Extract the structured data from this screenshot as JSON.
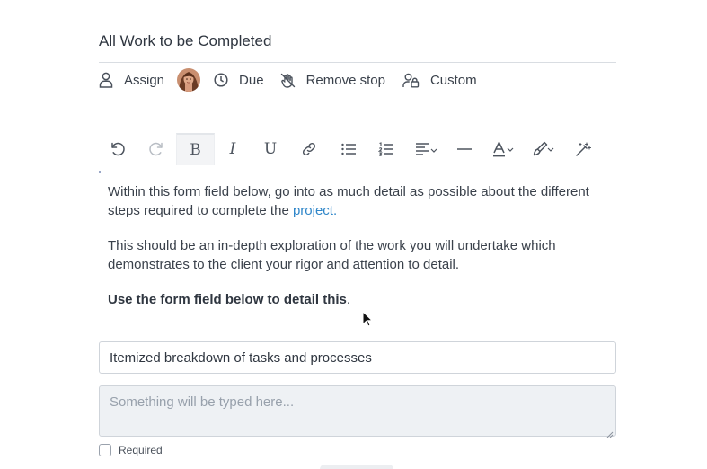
{
  "title": "All Work to be Completed",
  "meta": {
    "assign_label": "Assign",
    "due_label": "Due",
    "remove_stop_label": "Remove stop",
    "custom_label": "Custom"
  },
  "toolbar": {
    "items": [
      "undo-icon",
      "redo-icon",
      "bold",
      "italic",
      "underline",
      "link-icon",
      "bullet-list-icon",
      "numbered-list-icon",
      "align-icon",
      "horizontal-rule-icon",
      "text-color-icon",
      "highlight-icon",
      "clear-format-icon"
    ],
    "bold_glyph": "B",
    "italic_glyph": "I",
    "underline_glyph": "U",
    "active": "bold"
  },
  "content": {
    "p1_text": "Within this form field below, go into as much detail as possible about the different steps required to complete the ",
    "p1_link": "project.",
    "p2_text": "This should be an in-depth exploration of the work you will undertake which demonstrates to the client your rigor and attention to detail.",
    "p3_bold": "Use the form field below to detail this",
    "p3_tail": "."
  },
  "form": {
    "input_value": "Itemized breakdown of tasks and processes",
    "textarea_placeholder": "Something will be typed here...",
    "required_label": "Required",
    "required_checked": false
  },
  "colors": {
    "link": "#2f86c9",
    "text": "#3a414b",
    "border": "#cfd4da",
    "textarea_bg": "#eef1f4"
  }
}
